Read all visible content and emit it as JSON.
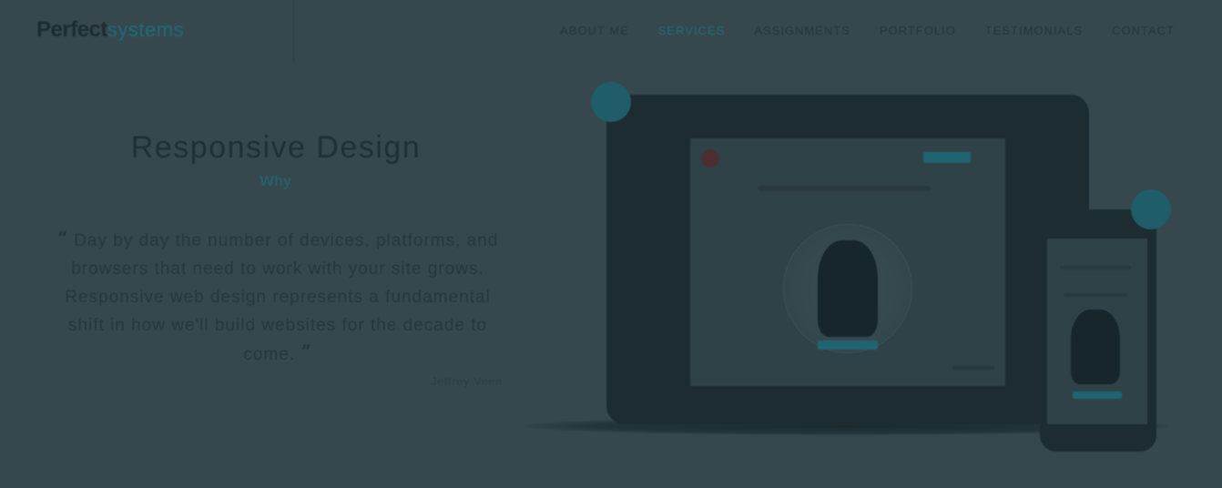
{
  "header": {
    "logo_main": "Perfect",
    "logo_accent": "systems",
    "nav": [
      {
        "label": "ABOUT ME",
        "active": false
      },
      {
        "label": "SERVICES",
        "active": true
      },
      {
        "label": "ASSIGNMENTS",
        "active": false
      },
      {
        "label": "PORTFOLIO",
        "active": false
      },
      {
        "label": "TESTIMONIALS",
        "active": false
      },
      {
        "label": "CONTACT",
        "active": false
      }
    ]
  },
  "hero": {
    "title": "Responsive Design",
    "tag": "Why",
    "quote_open": "“",
    "quote_text": "Day by day the number of devices, platforms, and browsers that need to work with your site grows. Responsive web design represents a fundamental shift in how we'll build websites for the decade to come.",
    "quote_close": "”",
    "author": "Jeffrey Veen"
  },
  "colors": {
    "background": "#36484d",
    "accent": "#1e6c7a",
    "device": "#1c2c31"
  },
  "icons": {
    "laptop_badge": "badge-icon",
    "phone_badge": "badge-icon"
  }
}
